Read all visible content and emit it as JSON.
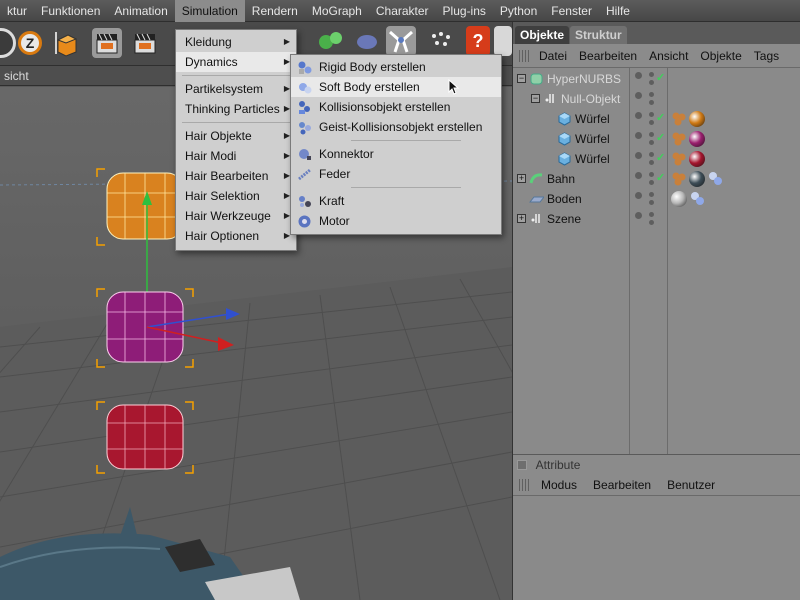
{
  "menubar": {
    "items": [
      "ktur",
      "Funktionen",
      "Animation",
      "Simulation",
      "Rendern",
      "MoGraph",
      "Charakter",
      "Plug-ins",
      "Python",
      "Fenster",
      "Hilfe"
    ],
    "active_index": 3
  },
  "viewport": {
    "header_label": "sicht"
  },
  "simulation_menu": {
    "items": [
      {
        "label": "Kleidung",
        "has_submenu": true
      },
      {
        "label": "Dynamics",
        "has_submenu": true,
        "highlighted": true
      },
      {
        "separator": true
      },
      {
        "label": "Partikelsystem",
        "has_submenu": true
      },
      {
        "label": "Thinking Particles",
        "has_submenu": true
      },
      {
        "separator": true
      },
      {
        "label": "Hair Objekte",
        "has_submenu": true
      },
      {
        "label": "Hair Modi",
        "has_submenu": true
      },
      {
        "label": "Hair Bearbeiten",
        "has_submenu": true
      },
      {
        "label": "Hair Selektion",
        "has_submenu": true
      },
      {
        "label": "Hair Werkzeuge",
        "has_submenu": true
      },
      {
        "label": "Hair Optionen",
        "has_submenu": true
      }
    ]
  },
  "dynamics_submenu": {
    "items": [
      {
        "label": "Rigid Body erstellen",
        "icon": "rigid-body-icon"
      },
      {
        "label": "Soft Body erstellen",
        "icon": "soft-body-icon",
        "highlighted": true
      },
      {
        "label": "Kollisionsobjekt erstellen",
        "icon": "collision-icon"
      },
      {
        "label": "Geist-Kollisionsobjekt erstellen",
        "icon": "ghost-collision-icon"
      },
      {
        "separator": true
      },
      {
        "label": "Konnektor",
        "icon": "connector-icon"
      },
      {
        "label": "Feder",
        "icon": "spring-icon"
      },
      {
        "separator": true
      },
      {
        "label": "Kraft",
        "icon": "force-icon"
      },
      {
        "label": "Motor",
        "icon": "motor-icon"
      }
    ]
  },
  "objects_panel": {
    "tabs": [
      {
        "label": "Objekte",
        "active": true
      },
      {
        "label": "Struktur",
        "active": false
      }
    ],
    "menu": [
      "Datei",
      "Bearbeiten",
      "Ansicht",
      "Objekte",
      "Tags"
    ],
    "rows": [
      {
        "name": "HyperNURBS",
        "indent": 0,
        "expand": "minus",
        "icon": "hypernurbs-icon",
        "dimmed": true,
        "check": true,
        "materials": []
      },
      {
        "name": "Null-Objekt",
        "indent": 1,
        "expand": "minus",
        "icon": "null-object-icon",
        "dimmed": true,
        "check": false,
        "materials": []
      },
      {
        "name": "Würfel",
        "indent": 2,
        "expand": "",
        "icon": "cube-icon",
        "dimmed": false,
        "check": true,
        "materials": [
          "#c9803a",
          "#d07a14"
        ]
      },
      {
        "name": "Würfel",
        "indent": 2,
        "expand": "",
        "icon": "cube-icon",
        "dimmed": false,
        "check": true,
        "materials": [
          "#c9803a",
          "#9a1f6e"
        ]
      },
      {
        "name": "Würfel",
        "indent": 2,
        "expand": "",
        "icon": "cube-icon",
        "dimmed": false,
        "check": true,
        "materials": [
          "#c9803a",
          "#a5152e"
        ]
      },
      {
        "name": "Bahn",
        "indent": 0,
        "expand": "plus",
        "icon": "track-icon",
        "dimmed": false,
        "check": true,
        "materials": [
          "#c9803a",
          "#3d4d57",
          "dyn"
        ]
      },
      {
        "name": "Boden",
        "indent": 0,
        "expand": "",
        "icon": "floor-icon",
        "dimmed": false,
        "check": false,
        "materials": [
          "#b8b8b8",
          "dyn"
        ]
      },
      {
        "name": "Szene",
        "indent": 0,
        "expand": "plus",
        "icon": "null-object-icon",
        "dimmed": false,
        "check": false,
        "materials": []
      }
    ]
  },
  "attributes_panel": {
    "title": "Attribute",
    "menu": [
      "Modus",
      "Bearbeiten",
      "Benutzer"
    ]
  },
  "colors": {
    "menu_highlight": "#8c8c8c",
    "check_green": "#3fd05a",
    "cube_orange": "#d9821f",
    "cube_purple": "#8e1d78",
    "cube_red": "#a8172f"
  }
}
